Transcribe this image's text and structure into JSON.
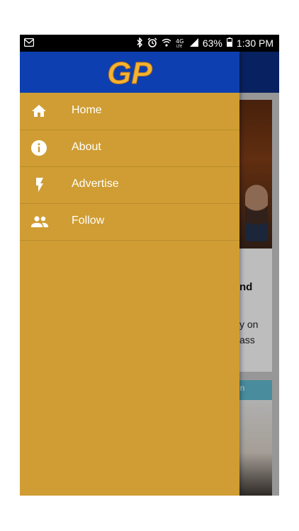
{
  "status_bar": {
    "battery": "63%",
    "time": "1:30 PM",
    "network": "4G LTE",
    "icons": [
      "mail-notification-icon",
      "bluetooth-icon",
      "alarm-icon",
      "wifi-icon",
      "signal-icon",
      "battery-icon"
    ]
  },
  "drawer": {
    "logo_text": "GP",
    "background_color": "#cf9d33",
    "header_color": "#0d3fb0",
    "logo_color": "#f5b331",
    "items": [
      {
        "label": "Home",
        "icon": "home-icon"
      },
      {
        "label": "About",
        "icon": "info-icon"
      },
      {
        "label": "Advertise",
        "icon": "flash-icon"
      },
      {
        "label": "Follow",
        "icon": "people-icon"
      }
    ]
  },
  "background": {
    "app_header_color": "#0a2a7a",
    "card1": {
      "title_fragment": "nd",
      "body_line1": "y on",
      "body_line2": "ass"
    },
    "card2": {
      "tag_fragment": "in"
    }
  }
}
